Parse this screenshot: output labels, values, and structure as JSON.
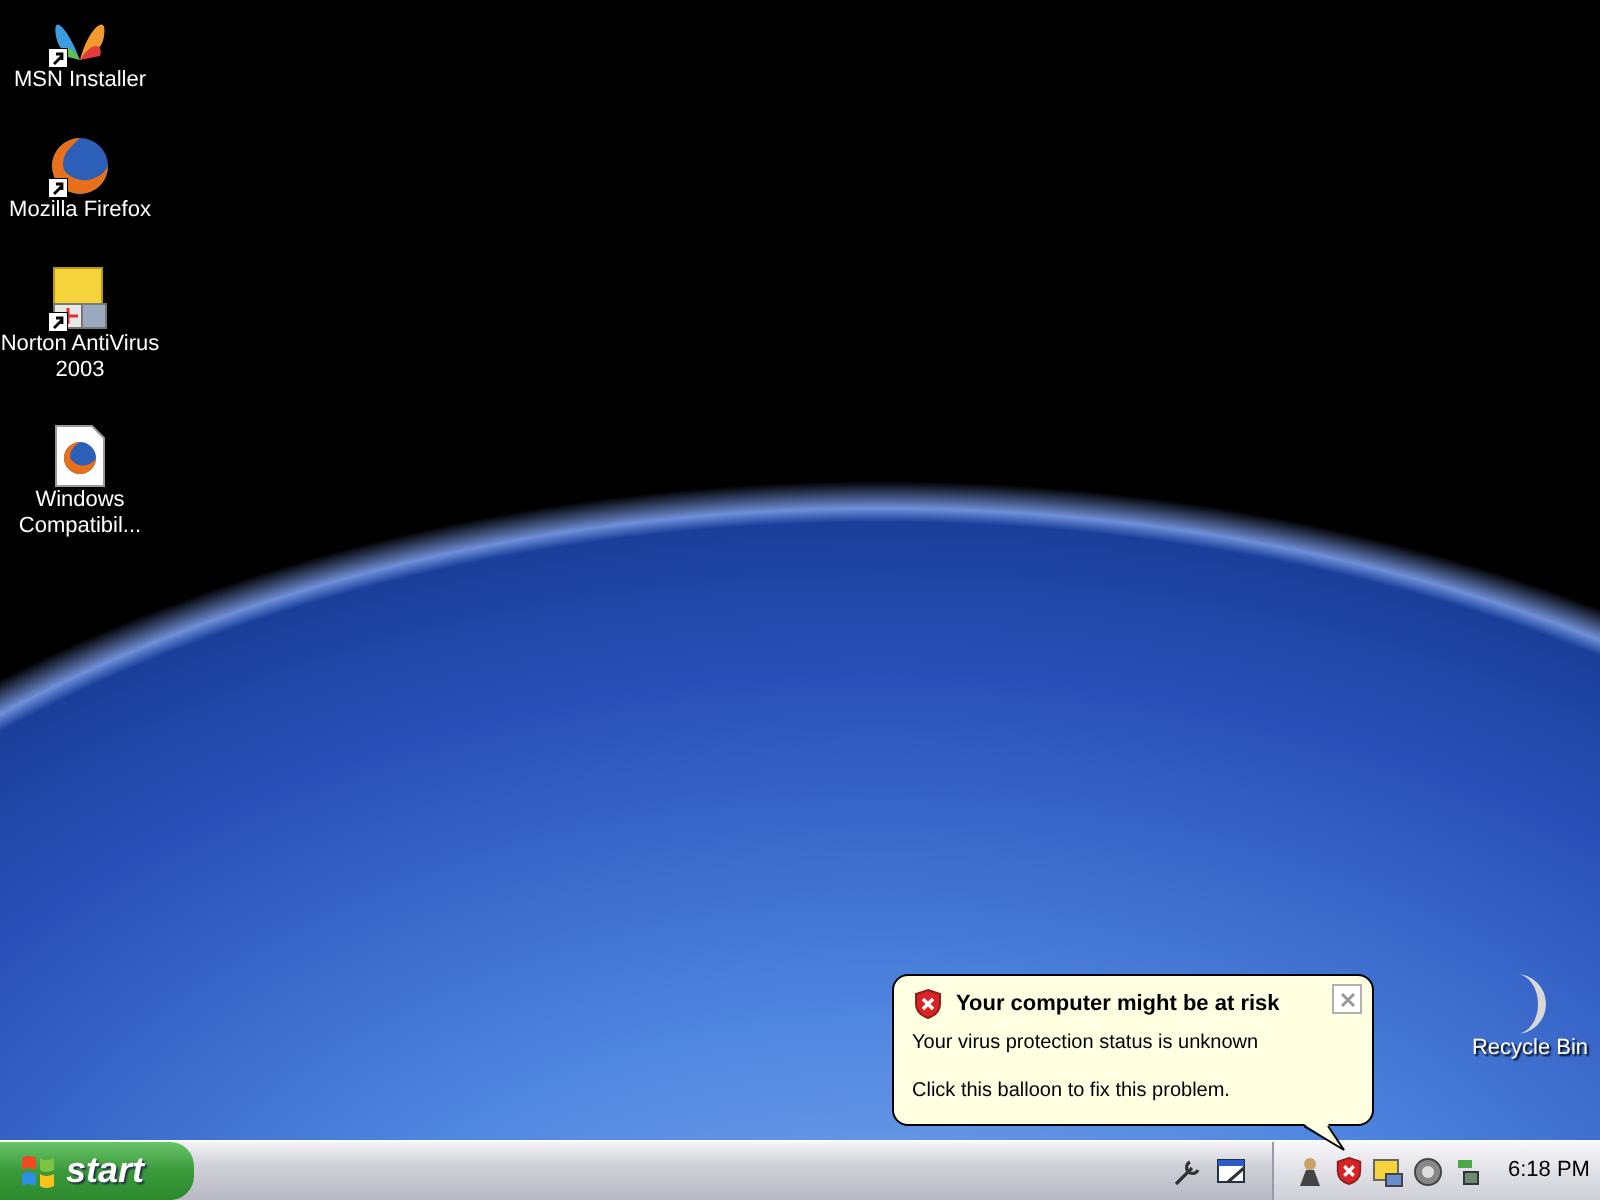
{
  "desktop_icons": [
    {
      "label": "MSN Installer",
      "kind": "butterfly",
      "shortcut": true
    },
    {
      "label": "Mozilla Firefox",
      "kind": "firefox",
      "shortcut": true
    },
    {
      "label": "Norton AntiVirus 2003",
      "kind": "norton",
      "shortcut": true
    },
    {
      "label": "Windows Compatibil...",
      "kind": "document",
      "shortcut": false
    }
  ],
  "recycle_bin": {
    "label": "Recycle Bin"
  },
  "balloon": {
    "title": "Your computer might be at risk",
    "lines": [
      "Your virus protection status is unknown",
      "Click this balloon to fix this problem."
    ]
  },
  "taskbar": {
    "start_label": "start",
    "clock": "6:18 PM"
  }
}
